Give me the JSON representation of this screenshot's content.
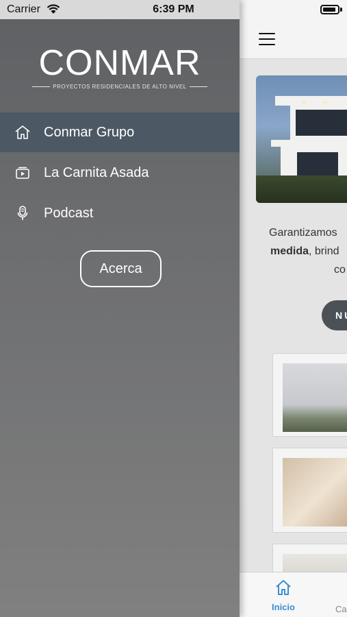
{
  "status_bar": {
    "carrier": "Carrier",
    "time": "6:39 PM"
  },
  "drawer": {
    "logo": {
      "brand": "CONMAR",
      "tagline": "PROYECTOS RESIDENCIALES DE ALTO NIVEL"
    },
    "menu": [
      {
        "label": "Conmar Grupo",
        "icon": "home-icon",
        "selected": true
      },
      {
        "label": "La Carnita Asada",
        "icon": "video-player-icon",
        "selected": false
      },
      {
        "label": "Podcast",
        "icon": "microphone-icon",
        "selected": false
      }
    ],
    "about_button": "Acerca"
  },
  "main": {
    "paragraph": {
      "line1": "Garantizamos",
      "line2_bold": "medida",
      "line2_rest": ", brind",
      "line3": "co"
    },
    "section_button": "NU",
    "tabs": [
      {
        "label": "Inicio",
        "icon": "home-icon",
        "active": true
      },
      {
        "label": "Ca",
        "active": false
      }
    ]
  },
  "colors": {
    "drawer_selected": "#4c5964",
    "tab_active": "#3a8fd0",
    "accent_button": "#4b5157"
  }
}
